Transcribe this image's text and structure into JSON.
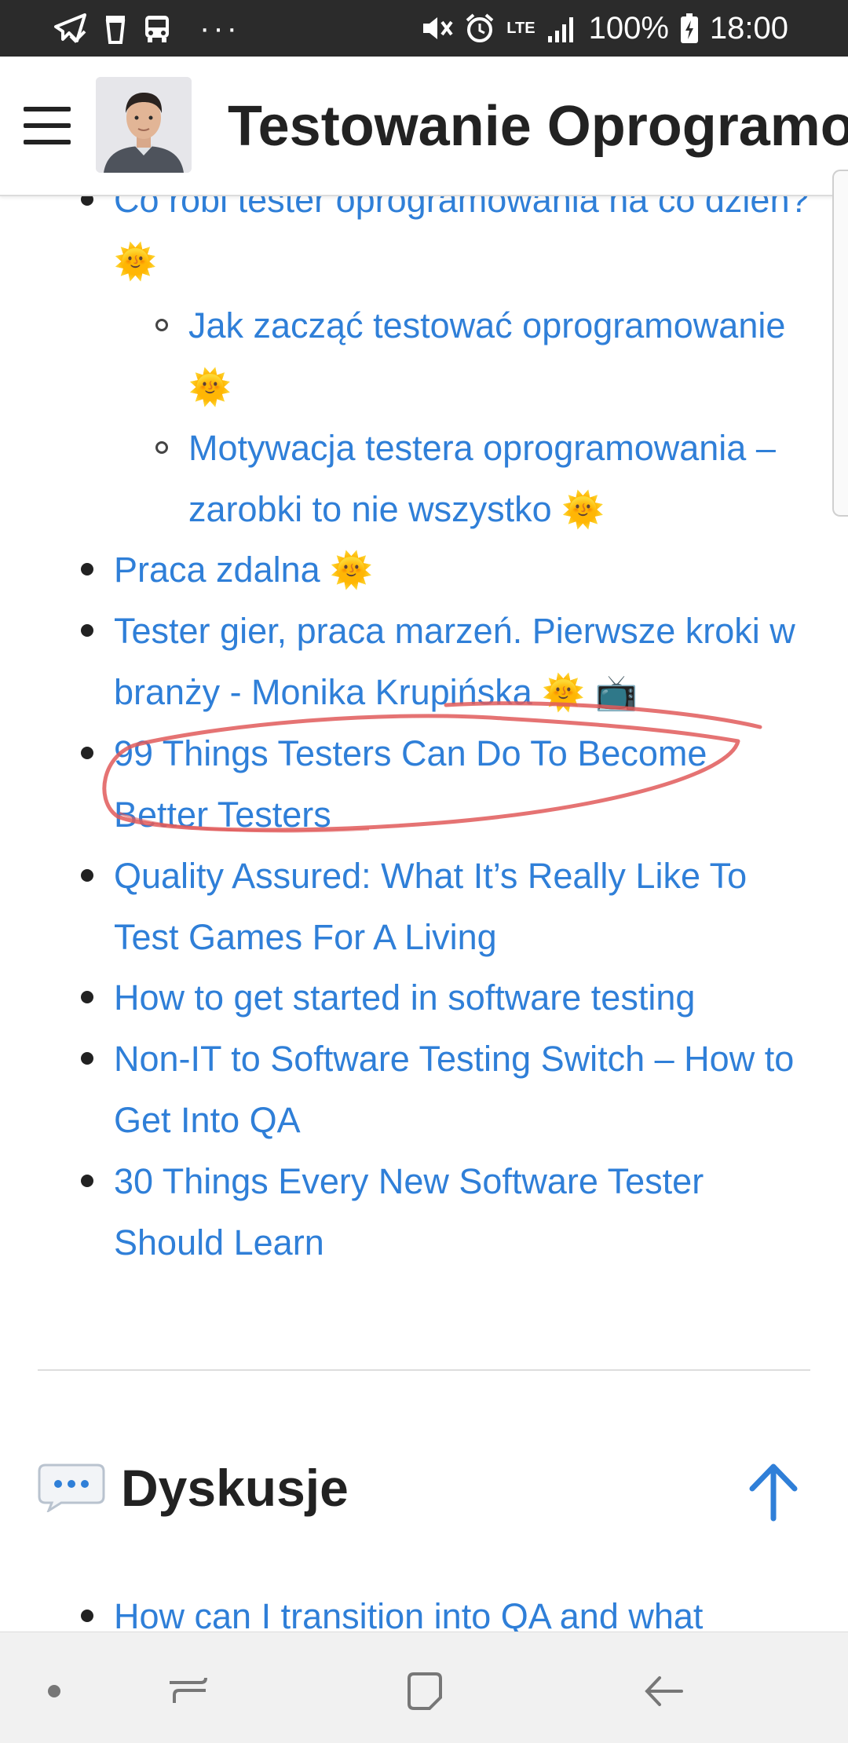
{
  "status_bar": {
    "left_icons": [
      "telegram-check-icon",
      "trash-icon",
      "bus-icon"
    ],
    "more": "···",
    "network": "LTE",
    "battery": "100%",
    "time": "18:00"
  },
  "header": {
    "title": "Testowanie Oprogramowania"
  },
  "links": [
    {
      "text": "Co robi tester oprogramowania na co dzień?",
      "emoji": "🌞",
      "level": 1
    },
    {
      "text": "Jak zacząć testować oprogramowanie",
      "emoji": "🌞",
      "level": 2
    },
    {
      "text": "Motywacja testera oprogramowania – zarobki to nie wszystko",
      "emoji": "🌞",
      "level": 2
    },
    {
      "text": "Praca zdalna",
      "emoji": "🌞",
      "level": 1
    },
    {
      "text": "Tester gier, praca marzeń. Pierwsze kroki w branży - Monika Krupińska",
      "emoji": "🌞",
      "emoji2": "📺",
      "level": 1
    },
    {
      "text": "99 Things Testers Can Do To Become Better Testers",
      "level": 1,
      "annotated": true
    },
    {
      "text": "Quality Assured: What It’s Really Like To Test Games For A Living",
      "level": 1
    },
    {
      "text": "How to get started in software testing",
      "level": 1
    },
    {
      "text": "Non-IT to Software Testing Switch – How to Get Into QA",
      "level": 1
    },
    {
      "text": "30 Things Every New Software Tester Should Learn",
      "level": 1
    }
  ],
  "section": {
    "icon": "speech-balloon-icon",
    "title": "Dyskusje",
    "first_link": "How can I transition into QA and what"
  },
  "nav_bar": {
    "buttons": [
      "home-dot-icon",
      "recent-apps-icon",
      "home-square-icon",
      "back-arrow-icon"
    ]
  },
  "colors": {
    "link": "#2f7fd8",
    "status_bar_bg": "#2b2b2b",
    "annotation": "#e05a5a",
    "sun": "#f5b400"
  }
}
